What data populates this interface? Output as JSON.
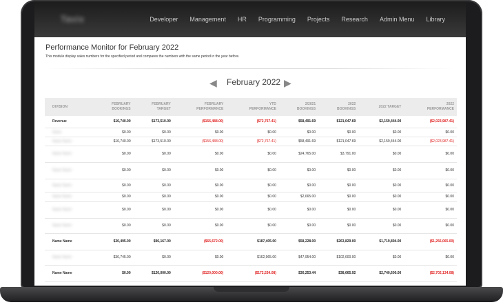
{
  "nav": {
    "brand": "Tavix",
    "items": [
      "Developer",
      "Management",
      "HR",
      "Programming",
      "Projects",
      "Research",
      "Admin Menu",
      "Library"
    ]
  },
  "page": {
    "title": "Performance Monitor for February 2022",
    "description": "This module display sales numbers for the specified period and compares the numbers with the same period in the year before."
  },
  "month": {
    "label": "February 2022"
  },
  "table": {
    "headers": [
      "DIVISION",
      "FEBRUARY\nBOOKINGS",
      "FEBRUARY\nTARGET",
      "FEBRUARY\nPERFORMANCE",
      "YTD\nPERFORMANCE",
      "2/2021\nBOOKINGS",
      "2022\nBOOKINGS",
      "2022 TARGET",
      "2022\nPERFORMANCE"
    ],
    "rows": [
      {
        "division": "Revenue",
        "cells": [
          "$16,740.00",
          "$173,510.00",
          "($156,488.00)",
          "($72,767.41)",
          "$58,491.69",
          "$121,047.69",
          "$2,159,444.00",
          "($2,023,987.41)"
        ],
        "neg": [
          2,
          3,
          7
        ],
        "h": 17,
        "bold": true
      },
      {
        "division": "Name",
        "cells": [
          "$0.00",
          "$0.00",
          "$0.00",
          "$0.00",
          "$0.00",
          "$0.00",
          "$0.00",
          "$0.00"
        ],
        "neg": [],
        "h": 13
      },
      {
        "division": "Name Name",
        "cells": [
          "$16,740.00",
          "$173,510.00",
          "($156,488.00)",
          "($72,767.41)",
          "$58,491.69",
          "$121,047.69",
          "$2,159,444.00",
          "($2,023,987.41)"
        ],
        "neg": [
          2,
          3,
          7
        ],
        "h": 13
      },
      {
        "division": "Name Name",
        "cells": [
          "$0.00",
          "$0.00",
          "$0.00",
          "$0.00",
          "$24,765.00",
          "$3,791.00",
          "$0.00",
          "$0.00"
        ],
        "neg": [],
        "h": 24
      },
      {
        "division": "Name Name",
        "cells": [
          "$0.00",
          "$0.00",
          "$0.00",
          "$0.00",
          "$0.00",
          "$0.00",
          "$0.00",
          "$0.00"
        ],
        "neg": [],
        "h": 24
      },
      {
        "division": "Name Name",
        "cells": [
          "$0.00",
          "$0.00",
          "$0.00",
          "$0.00",
          "$0.00",
          "$0.00",
          "$0.00",
          "$0.00"
        ],
        "neg": [],
        "h": 19
      },
      {
        "division": "Name Name",
        "cells": [
          "$0.00",
          "$0.00",
          "$0.00",
          "$0.00",
          "$2,665.00",
          "$0.00",
          "$0.00",
          "$0.00"
        ],
        "neg": [],
        "h": 14
      },
      {
        "division": "Name Name",
        "cells": [
          "$0.00",
          "$0.00",
          "$0.00",
          "$0.00",
          "$0.00",
          "$0.00",
          "$0.00",
          "$0.00"
        ],
        "neg": [],
        "h": 24
      },
      {
        "division": "Name Name",
        "cells": [
          "$0.00",
          "$0.00",
          "$0.00",
          "$0.00",
          "$0.00",
          "$0.00",
          "$0.00",
          "$0.00"
        ],
        "neg": [],
        "h": 22
      },
      {
        "division": "Name Name",
        "cells": [
          "$30,495.00",
          "$96,167.00",
          "($65,672.00)",
          "$187,405.00",
          "$58,228.00",
          "$263,829.00",
          "$1,719,894.00",
          "($1,256,065.00)"
        ],
        "neg": [
          2,
          7
        ],
        "h": 24,
        "bold": true
      },
      {
        "division": "Name Name",
        "cells": [
          "$36,745.00",
          "$0.00",
          "$0.00",
          "$162,965.00",
          "$47,954.00",
          "$102,600.00",
          "$0.00",
          "$0.00"
        ],
        "neg": [],
        "h": 22
      },
      {
        "division": "Name Name",
        "cells": [
          "$0.00",
          "$120,000.00",
          "($120,000.00)",
          "($172,534.08)",
          "$30,253.44",
          "$38,665.92",
          "$2,740,600.00",
          "($2,702,134.08)"
        ],
        "neg": [
          2,
          3,
          7
        ],
        "h": 24,
        "bold": true
      }
    ]
  }
}
